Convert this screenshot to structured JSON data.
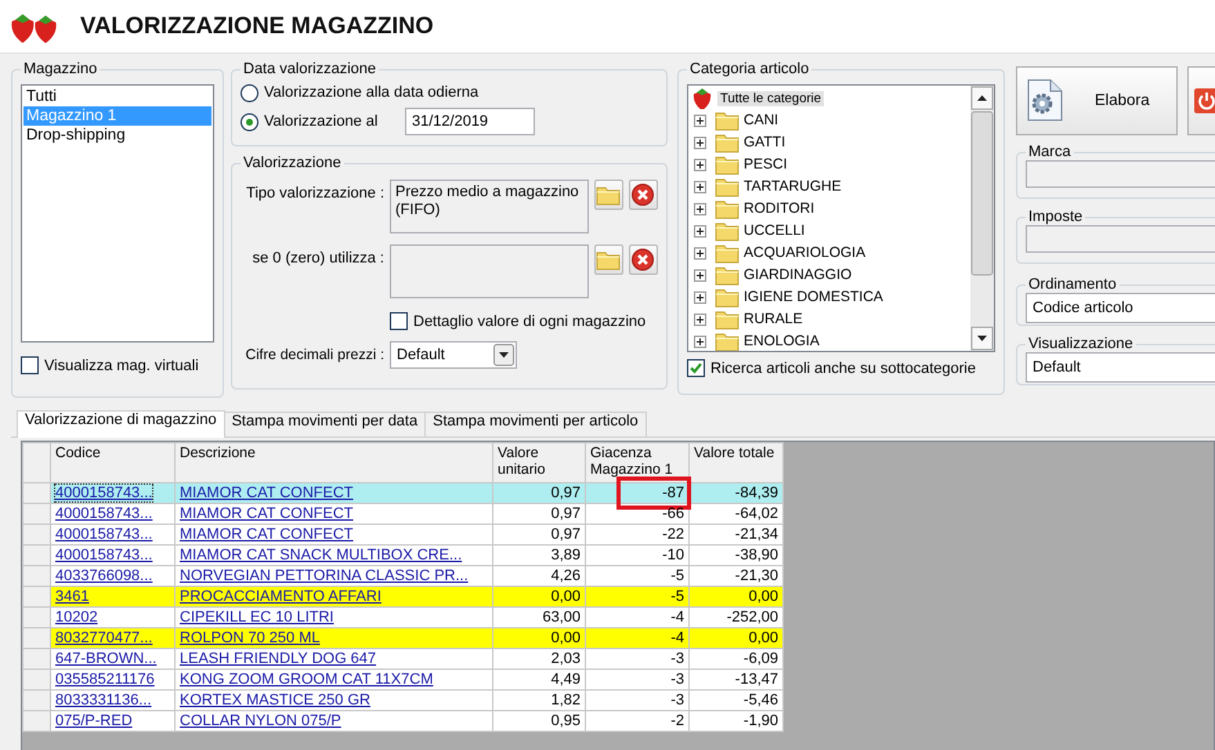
{
  "window": {
    "title": "VALORIZZAZIONE MAGAZZINO"
  },
  "magazzino": {
    "label": "Magazzino",
    "items": [
      {
        "label": "Tutti",
        "selected": false
      },
      {
        "label": "Magazzino 1",
        "selected": true
      },
      {
        "label": "Drop-shipping",
        "selected": false
      }
    ],
    "virtual": {
      "label": "Visualizza mag. virtuali",
      "checked": false
    }
  },
  "data_valorizzazione": {
    "label": "Data valorizzazione",
    "options": [
      {
        "label": "Valorizzazione alla data odierna",
        "selected": false
      },
      {
        "label": "Valorizzazione al",
        "selected": true
      }
    ],
    "date": "31/12/2019"
  },
  "valorizzazione": {
    "label": "Valorizzazione",
    "tipo": {
      "label": "Tipo valorizzazione :",
      "value": "Prezzo medio a magazzino (FIFO)"
    },
    "fallback": {
      "label": "se 0 (zero) utilizza :"
    },
    "detail": {
      "label": "Dettaglio valore di ogni magazzino",
      "checked": false
    },
    "decimals": {
      "label": "Cifre decimali prezzi :",
      "value": "Default"
    }
  },
  "categoria": {
    "label": "Categoria articolo",
    "root": {
      "label": "Tutte le categorie",
      "selected": true,
      "children": [
        {
          "label": "CANI",
          "expanded": false
        },
        {
          "label": "GATTI",
          "expanded": false
        },
        {
          "label": "PESCI",
          "expanded": false
        },
        {
          "label": "TARTARUGHE",
          "expanded": false
        },
        {
          "label": "RODITORI",
          "expanded": false
        },
        {
          "label": "UCCELLI",
          "expanded": false
        },
        {
          "label": "ACQUARIOLOGIA",
          "expanded": false
        },
        {
          "label": "GIARDINAGGIO",
          "expanded": false
        },
        {
          "label": "IGIENE DOMESTICA",
          "expanded": false
        },
        {
          "label": "RURALE",
          "expanded": false
        },
        {
          "label": "ENOLOGIA",
          "expanded": false
        }
      ]
    },
    "subcategories": {
      "label": "Ricerca articoli anche su sottocategorie",
      "checked": true
    }
  },
  "actions": [
    {
      "kind": "process",
      "label": "Elabora"
    },
    {
      "kind": "exit"
    }
  ],
  "filters": [
    {
      "kind": "field",
      "label": "Marca"
    },
    {
      "kind": "field",
      "label": "Imposte"
    },
    {
      "kind": "select",
      "label": "Ordinamento",
      "value": "Codice articolo"
    },
    {
      "kind": "select",
      "label": "Visualizzazione",
      "value": "Default"
    }
  ],
  "tabs": [
    {
      "label": "Valorizzazione di magazzino",
      "selected": true
    },
    {
      "label": "Stampa movimenti per data",
      "selected": false
    },
    {
      "label": "Stampa movimenti per articolo",
      "selected": false
    }
  ],
  "table": {
    "columns": [
      "Codice",
      "Descrizione",
      "Valore unitario",
      "Giacenza Magazzino 1",
      "Valore totale"
    ],
    "rows": [
      {
        "cells": [
          "4000158743...",
          "MIAMOR CAT CONFECT",
          "0,97",
          "-87",
          "-84,39"
        ],
        "selected": true,
        "highlighted": false,
        "flagged": true
      },
      {
        "cells": [
          "4000158743...",
          "MIAMOR CAT CONFECT",
          "0,97",
          "-66",
          "-64,02"
        ],
        "selected": false,
        "highlighted": false,
        "flagged": false
      },
      {
        "cells": [
          "4000158743...",
          "MIAMOR CAT CONFECT",
          "0,97",
          "-22",
          "-21,34"
        ],
        "selected": false,
        "highlighted": false,
        "flagged": false
      },
      {
        "cells": [
          "4000158743...",
          "MIAMOR CAT SNACK MULTIBOX CRE...",
          "3,89",
          "-10",
          "-38,90"
        ],
        "selected": false,
        "highlighted": false,
        "flagged": false
      },
      {
        "cells": [
          "4033766098...",
          "NORVEGIAN PETTORINA CLASSIC PR...",
          "4,26",
          "-5",
          "-21,30"
        ],
        "selected": false,
        "highlighted": false,
        "flagged": false
      },
      {
        "cells": [
          "3461",
          "PROCACCIAMENTO AFFARI",
          "0,00",
          "-5",
          "0,00"
        ],
        "selected": false,
        "highlighted": true,
        "flagged": false
      },
      {
        "cells": [
          "10202",
          "CIPEKILL EC  10 LITRI",
          "63,00",
          "-4",
          "-252,00"
        ],
        "selected": false,
        "highlighted": false,
        "flagged": false
      },
      {
        "cells": [
          "8032770477...",
          "ROLPON 70   250 ML",
          "0,00",
          "-4",
          "0,00"
        ],
        "selected": false,
        "highlighted": true,
        "flagged": false
      },
      {
        "cells": [
          "647-BROWN...",
          "LEASH FRIENDLY DOG 647",
          "2,03",
          "-3",
          "-6,09"
        ],
        "selected": false,
        "highlighted": false,
        "flagged": false
      },
      {
        "cells": [
          "035585211176",
          "KONG ZOOM GROOM CAT  11X7CM",
          "4,49",
          "-3",
          "-13,47"
        ],
        "selected": false,
        "highlighted": false,
        "flagged": false
      },
      {
        "cells": [
          "8033331136...",
          "KORTEX MASTICE 250 GR",
          "1,82",
          "-3",
          "-5,46"
        ],
        "selected": false,
        "highlighted": false,
        "flagged": false
      },
      {
        "cells": [
          "075/P-RED",
          "COLLAR NYLON 075/P",
          "0,95",
          "-2",
          "-1,90"
        ],
        "selected": false,
        "highlighted": false,
        "flagged": false
      }
    ]
  }
}
